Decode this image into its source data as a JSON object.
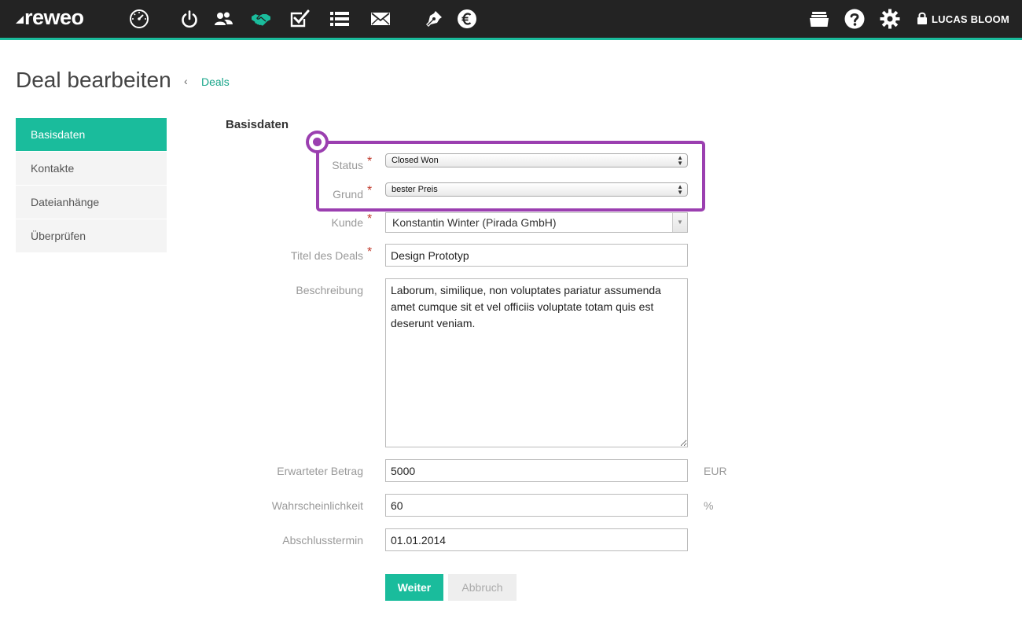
{
  "app": {
    "logo": "reweo",
    "user_name": "LUCAS BLOOM"
  },
  "nav_icons": [
    "speedometer-icon",
    "power-icon",
    "contacts-icon",
    "handshake-icon",
    "checkbox-icon",
    "list-icon",
    "mail-icon",
    "pen-icon",
    "euro-icon"
  ],
  "right_icons": [
    "folder-icon",
    "help-icon",
    "gear-icon",
    "lock-icon"
  ],
  "colors": {
    "accent": "#1abc9c",
    "topbar": "#232323",
    "highlight": "#9b3fb0",
    "required": "#c0392b"
  },
  "page": {
    "title": "Deal bearbeiten",
    "breadcrumb": "Deals"
  },
  "sidenav": [
    {
      "label": "Basisdaten",
      "active": true
    },
    {
      "label": "Kontakte",
      "active": false
    },
    {
      "label": "Dateianhänge",
      "active": false
    },
    {
      "label": "Überprüfen",
      "active": false
    }
  ],
  "form": {
    "section_title": "Basisdaten",
    "status": {
      "label": "Status",
      "value": "Closed Won"
    },
    "grund": {
      "label": "Grund",
      "value": "bester Preis"
    },
    "kunde": {
      "label": "Kunde",
      "value": "Konstantin Winter (Pirada GmbH)"
    },
    "titel": {
      "label": "Titel des Deals",
      "value": "Design Prototyp"
    },
    "beschreibung": {
      "label": "Beschreibung",
      "value": "Laborum, similique, non voluptates pariatur assumenda amet cumque sit et vel officiis voluptate totam quis est deserunt veniam."
    },
    "betrag": {
      "label": "Erwarteter Betrag",
      "value": "5000",
      "unit": "EUR"
    },
    "wahrscheinlichkeit": {
      "label": "Wahrscheinlichkeit",
      "value": "60",
      "unit": "%"
    },
    "abschlusstermin": {
      "label": "Abschlusstermin",
      "value": "01.01.2014"
    },
    "required_mark": "*"
  },
  "buttons": {
    "submit": "Weiter",
    "cancel": "Abbruch"
  }
}
